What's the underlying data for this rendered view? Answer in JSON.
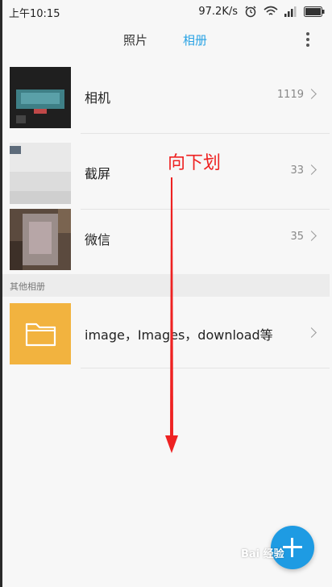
{
  "status_bar": {
    "time": "上午10:15",
    "net_speed": "97.2K/s",
    "icons": [
      "alarm-icon",
      "wifi-icon",
      "signal-icon",
      "battery-icon"
    ]
  },
  "tabs": [
    {
      "label": "照片",
      "active": false
    },
    {
      "label": "相册",
      "active": true
    }
  ],
  "accent_color": "#2aa3e4",
  "albums": [
    {
      "name": "相机",
      "count": "1119"
    },
    {
      "name": "截屏",
      "count": "33"
    },
    {
      "name": "微信",
      "count": "35"
    }
  ],
  "section_header": "其他相册",
  "other_albums": [
    {
      "name": "image，Images，download等"
    }
  ],
  "annotation": {
    "text": "向下划",
    "color": "#ee2222"
  },
  "fab": {
    "icon": "plus-icon",
    "color": "#1e9be3"
  },
  "watermark": "Bai 经验"
}
